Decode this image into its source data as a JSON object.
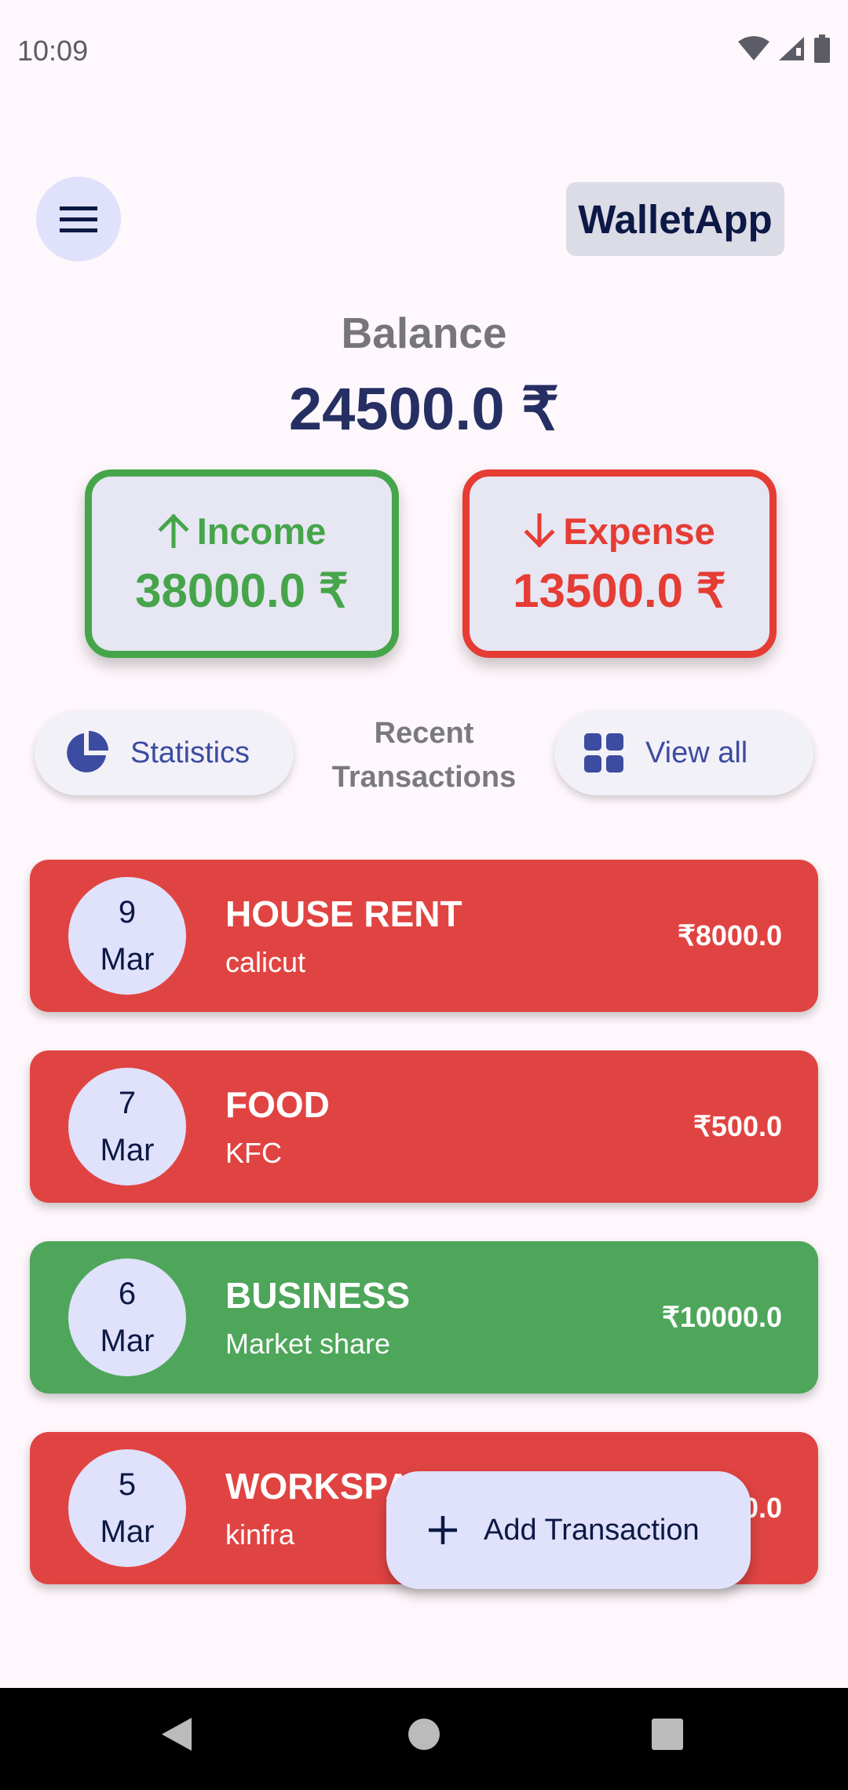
{
  "status_bar": {
    "time": "10:09"
  },
  "header": {
    "title": "WalletApp",
    "menu_icon": "menu-icon"
  },
  "balance": {
    "label": "Balance",
    "value": "24500.0 ₹"
  },
  "summary": {
    "income": {
      "label": "Income",
      "value": "38000.0 ₹",
      "color": "#46a54a",
      "icon": "arrow-up-icon"
    },
    "expense": {
      "label": "Expense",
      "value": "13500.0 ₹",
      "color": "#e53c34",
      "icon": "arrow-down-icon"
    }
  },
  "actions": {
    "statistics_label": "Statistics",
    "recent_label_line1": "Recent",
    "recent_label_line2": "Transactions",
    "view_all_label": "View all"
  },
  "transactions": [
    {
      "day": "9",
      "month": "Mar",
      "title": "HOUSE RENT",
      "subtitle": "calicut",
      "amount": "₹8000.0",
      "type": "expense"
    },
    {
      "day": "7",
      "month": "Mar",
      "title": "FOOD",
      "subtitle": "KFC",
      "amount": "₹500.0",
      "type": "expense"
    },
    {
      "day": "6",
      "month": "Mar",
      "title": "BUSINESS",
      "subtitle": "Market share",
      "amount": "₹10000.0",
      "type": "income"
    },
    {
      "day": "5",
      "month": "Mar",
      "title": "WORKSPACE RENT",
      "subtitle": "kinfra",
      "amount": "₹3000.0",
      "type": "expense"
    }
  ],
  "fab": {
    "label": "Add Transaction",
    "icon": "plus-icon"
  },
  "colors": {
    "expense_card": "#e04442",
    "income_card": "#4ea65a",
    "accent": "#3c4ca0"
  }
}
